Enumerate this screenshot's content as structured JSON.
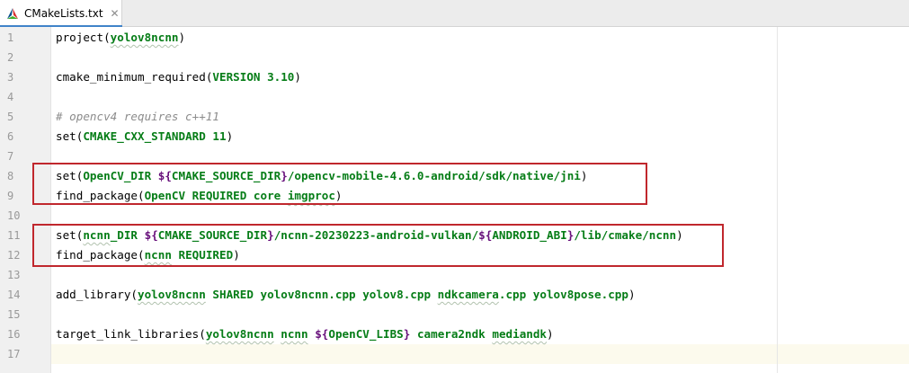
{
  "tab": {
    "label": "CMakeLists.txt",
    "close_glyph": "✕",
    "icon": "cmake-logo-icon"
  },
  "colors": {
    "command": "#000000",
    "argument": "#067d17",
    "variable": "#660e7a",
    "comment": "#8c8c8c",
    "highlight_border": "#c0272d",
    "tab_underline": "#4083c9"
  },
  "editor": {
    "lines": [
      {
        "number": "1",
        "tokens": [
          {
            "t": "cmd",
            "v": "project"
          },
          {
            "t": "paren",
            "v": "("
          },
          {
            "t": "arg",
            "v": "yolov8ncnn",
            "sq": true
          },
          {
            "t": "paren",
            "v": ")"
          }
        ]
      },
      {
        "number": "2",
        "tokens": []
      },
      {
        "number": "3",
        "tokens": [
          {
            "t": "cmd",
            "v": "cmake_minimum_required"
          },
          {
            "t": "paren",
            "v": "("
          },
          {
            "t": "arg",
            "v": "VERSION 3.10"
          },
          {
            "t": "paren",
            "v": ")"
          }
        ]
      },
      {
        "number": "4",
        "tokens": []
      },
      {
        "number": "5",
        "tokens": [
          {
            "t": "comment",
            "v": "# opencv4 requires c++11"
          }
        ]
      },
      {
        "number": "6",
        "tokens": [
          {
            "t": "cmd",
            "v": "set"
          },
          {
            "t": "paren",
            "v": "("
          },
          {
            "t": "arg",
            "v": "CMAKE_CXX_STANDARD 11"
          },
          {
            "t": "paren",
            "v": ")"
          }
        ]
      },
      {
        "number": "7",
        "tokens": []
      },
      {
        "number": "8",
        "tokens": [
          {
            "t": "cmd",
            "v": "set"
          },
          {
            "t": "paren",
            "v": "("
          },
          {
            "t": "arg",
            "v": "OpenCV_DIR "
          },
          {
            "t": "var",
            "v": "${"
          },
          {
            "t": "arg",
            "v": "CMAKE_SOURCE_DIR"
          },
          {
            "t": "var",
            "v": "}"
          },
          {
            "t": "arg",
            "v": "/opencv-mobile-4.6.0-android/sdk/native/jni"
          },
          {
            "t": "paren",
            "v": ")"
          }
        ]
      },
      {
        "number": "9",
        "tokens": [
          {
            "t": "cmd",
            "v": "find_package"
          },
          {
            "t": "paren",
            "v": "("
          },
          {
            "t": "arg",
            "v": "OpenCV REQUIRED core "
          },
          {
            "t": "arg",
            "v": "imgproc",
            "sq": true
          },
          {
            "t": "paren",
            "v": ")"
          }
        ]
      },
      {
        "number": "10",
        "tokens": []
      },
      {
        "number": "11",
        "tokens": [
          {
            "t": "cmd",
            "v": "set"
          },
          {
            "t": "paren",
            "v": "("
          },
          {
            "t": "arg",
            "v": "ncnn",
            "sq": true
          },
          {
            "t": "arg",
            "v": "_DIR "
          },
          {
            "t": "var",
            "v": "${"
          },
          {
            "t": "arg",
            "v": "CMAKE_SOURCE_DIR"
          },
          {
            "t": "var",
            "v": "}"
          },
          {
            "t": "arg",
            "v": "/ncnn-20230223-android-vulkan/"
          },
          {
            "t": "var",
            "v": "${"
          },
          {
            "t": "arg",
            "v": "ANDROID_ABI"
          },
          {
            "t": "var",
            "v": "}"
          },
          {
            "t": "arg",
            "v": "/lib/cmake/ncnn"
          },
          {
            "t": "paren",
            "v": ")"
          }
        ]
      },
      {
        "number": "12",
        "tokens": [
          {
            "t": "cmd",
            "v": "find_package"
          },
          {
            "t": "paren",
            "v": "("
          },
          {
            "t": "arg",
            "v": "ncnn",
            "sq": true
          },
          {
            "t": "arg",
            "v": " REQUIRED"
          },
          {
            "t": "paren",
            "v": ")"
          }
        ]
      },
      {
        "number": "13",
        "tokens": []
      },
      {
        "number": "14",
        "tokens": [
          {
            "t": "cmd",
            "v": "add_library"
          },
          {
            "t": "paren",
            "v": "("
          },
          {
            "t": "arg",
            "v": "yolov8ncnn",
            "sq": true
          },
          {
            "t": "arg",
            "v": " SHARED yolov8ncnn.cpp yolov8.cpp "
          },
          {
            "t": "arg",
            "v": "ndkcamera",
            "sq": true
          },
          {
            "t": "arg",
            "v": ".cpp yolov8pose.cpp"
          },
          {
            "t": "paren",
            "v": ")"
          }
        ]
      },
      {
        "number": "15",
        "tokens": []
      },
      {
        "number": "16",
        "tokens": [
          {
            "t": "cmd",
            "v": "target_link_libraries"
          },
          {
            "t": "paren",
            "v": "("
          },
          {
            "t": "arg",
            "v": "yolov8ncnn",
            "sq": true
          },
          {
            "t": "arg",
            "v": " "
          },
          {
            "t": "arg",
            "v": "ncnn",
            "sq": true
          },
          {
            "t": "arg",
            "v": " "
          },
          {
            "t": "var",
            "v": "${"
          },
          {
            "t": "arg",
            "v": "OpenCV_LIBS"
          },
          {
            "t": "var",
            "v": "}"
          },
          {
            "t": "arg",
            "v": " camera2ndk "
          },
          {
            "t": "arg",
            "v": "mediandk",
            "sq": true
          },
          {
            "t": "paren",
            "v": ")"
          }
        ]
      },
      {
        "number": "17",
        "tokens": []
      }
    ]
  }
}
